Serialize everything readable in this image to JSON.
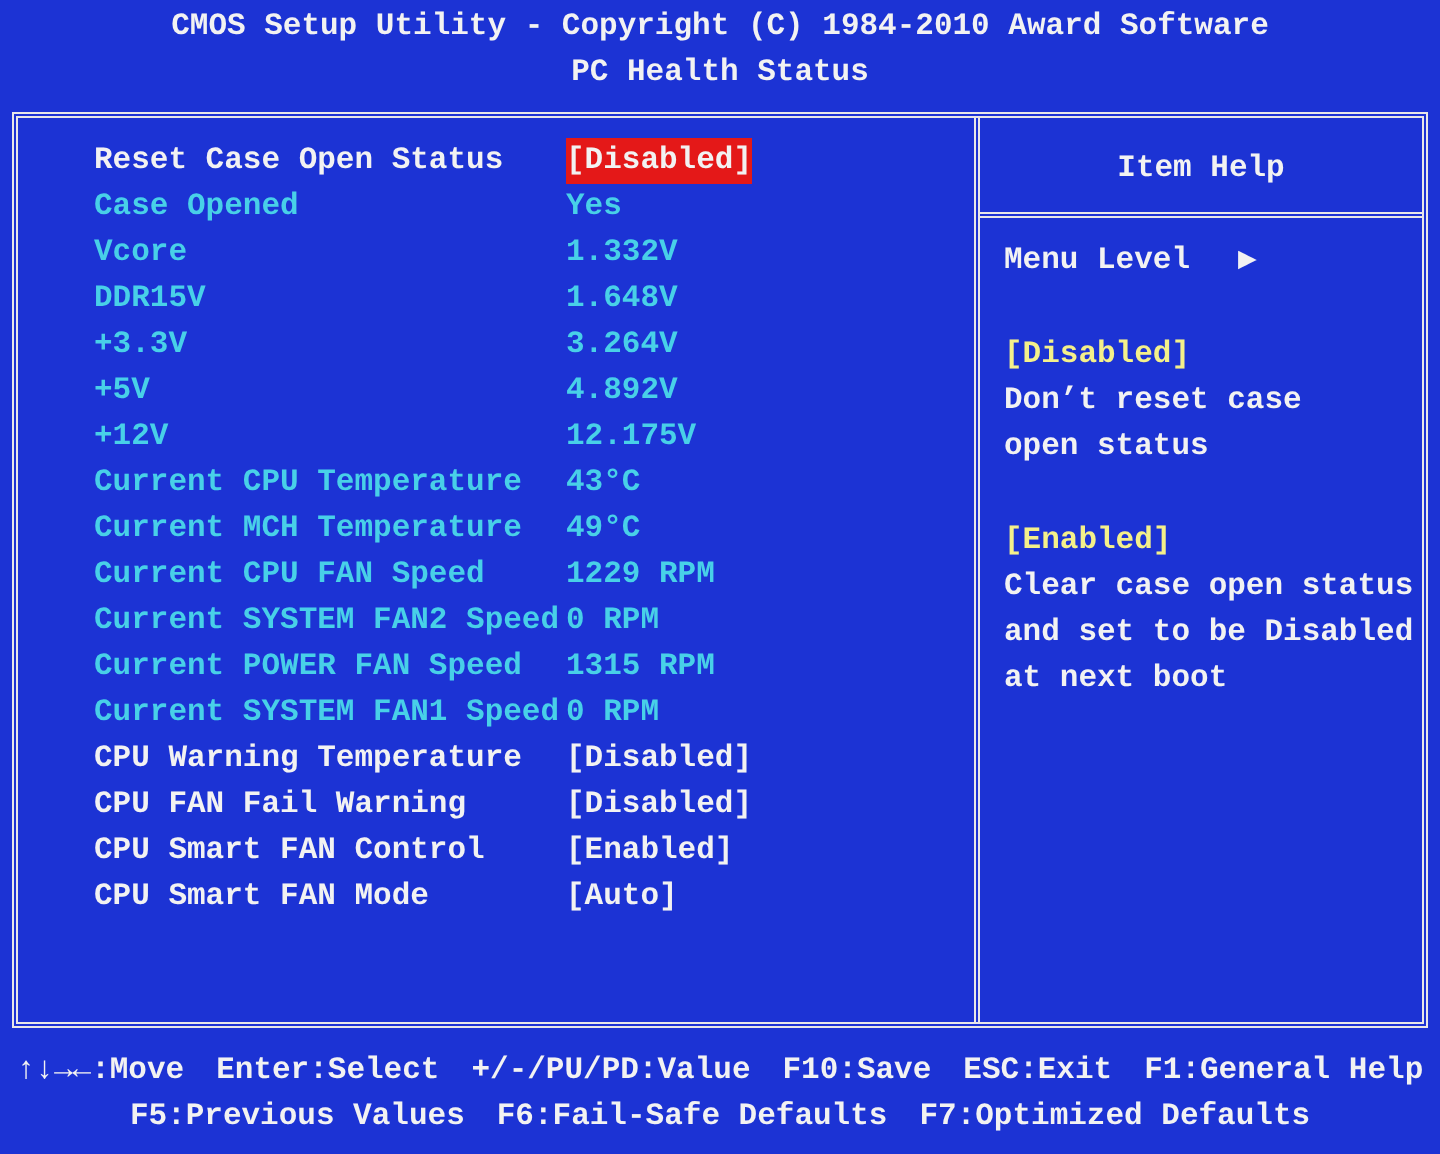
{
  "header": {
    "title": "CMOS Setup Utility - Copyright (C) 1984-2010 Award Software",
    "subtitle": "PC Health Status"
  },
  "items": [
    {
      "kind": "setting",
      "label": "Reset Case Open Status",
      "value": "[Disabled]",
      "selected": true
    },
    {
      "kind": "readout",
      "label": "Case Opened",
      "value": "Yes",
      "selected": false
    },
    {
      "kind": "readout",
      "label": "Vcore",
      "value": "1.332V",
      "selected": false
    },
    {
      "kind": "readout",
      "label": "DDR15V",
      "value": "1.648V",
      "selected": false
    },
    {
      "kind": "readout",
      "label": "+3.3V",
      "value": "3.264V",
      "selected": false
    },
    {
      "kind": "readout",
      "label": "+5V",
      "value": "4.892V",
      "selected": false
    },
    {
      "kind": "readout",
      "label": "+12V",
      "value": "12.175V",
      "selected": false
    },
    {
      "kind": "readout",
      "label": "Current CPU Temperature",
      "value": "43°C",
      "selected": false
    },
    {
      "kind": "readout",
      "label": "Current MCH Temperature",
      "value": "49°C",
      "selected": false
    },
    {
      "kind": "readout",
      "label": "Current CPU FAN Speed",
      "value": "1229 RPM",
      "selected": false
    },
    {
      "kind": "readout",
      "label": "Current SYSTEM FAN2 Speed",
      "value": "0 RPM",
      "selected": false
    },
    {
      "kind": "readout",
      "label": "Current POWER FAN Speed",
      "value": "1315 RPM",
      "selected": false
    },
    {
      "kind": "readout",
      "label": "Current SYSTEM FAN1 Speed",
      "value": "0 RPM",
      "selected": false
    },
    {
      "kind": "setting",
      "label": "CPU Warning Temperature",
      "value": "[Disabled]",
      "selected": false
    },
    {
      "kind": "setting",
      "label": "CPU FAN Fail Warning",
      "value": "[Disabled]",
      "selected": false
    },
    {
      "kind": "setting",
      "label": "CPU Smart FAN Control",
      "value": "[Enabled]",
      "selected": false
    },
    {
      "kind": "setting",
      "label": "CPU Smart FAN Mode",
      "value": "[Auto]",
      "selected": false
    }
  ],
  "help": {
    "title": "Item Help",
    "menu_level": "Menu Level",
    "menu_level_arrow": "▶",
    "entries": [
      {
        "heading": "[Disabled]",
        "lines": [
          "Don’t reset case",
          "open status"
        ]
      },
      {
        "heading": "[Enabled]",
        "lines": [
          "Clear case open status",
          "and set to be Disabled",
          "at next boot"
        ]
      }
    ]
  },
  "footer": [
    [
      "↑↓→←:Move",
      "Enter:Select",
      "+/-/PU/PD:Value",
      "F10:Save",
      "ESC:Exit",
      "F1:General Help"
    ],
    [
      "F5:Previous Values",
      "F6:Fail-Safe Defaults",
      "F7:Optimized Defaults"
    ]
  ]
}
